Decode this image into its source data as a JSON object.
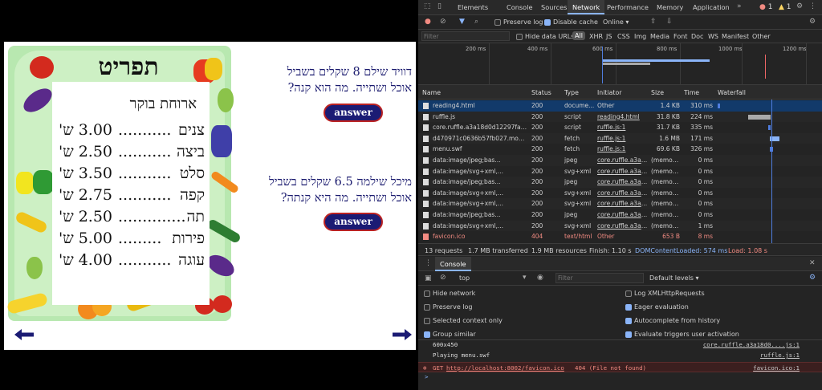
{
  "game": {
    "menu_title": "תפריט",
    "menu_subtitle": "ארוחת בוקר",
    "items": [
      {
        "name": "צנים",
        "dots": "...........",
        "price": "3.00 ש'"
      },
      {
        "name": "ביצה",
        "dots": "...........",
        "price": "2.50 ש'"
      },
      {
        "name": "סלט",
        "dots": "...........",
        "price": "3.50 ש'"
      },
      {
        "name": "קפה",
        "dots": "...........",
        "price": "2.75 ש'"
      },
      {
        "name": "תה",
        "dots": "..............",
        "price": "2.50 ש'"
      },
      {
        "name": "פירות",
        "dots": ".........",
        "price": "5.00 ש'"
      },
      {
        "name": "עוגה",
        "dots": "...........",
        "price": "4.00 ש'"
      }
    ],
    "question1_line1": "דוויד שילם 8 שקלים בשביל",
    "question1_line2": "אוכל ושתייה. מה הוא קנה?",
    "question2_line1": "מיכל שילמה 6.5 שקלים בשביל",
    "question2_line2": "אוכל ושתייה. מה היא קנתה?",
    "answer_label": "answer",
    "arrow_left": "←",
    "arrow_right": "→"
  },
  "devtools": {
    "tabs": [
      "Elements",
      "Console",
      "Sources",
      "Network",
      "Performance",
      "Memory",
      "Application"
    ],
    "active_tab": "Network",
    "more_tabs": "»",
    "error_count": "1",
    "warn_count": "1",
    "toolbar": {
      "preserve_log": "Preserve log",
      "disable_cache": "Disable cache",
      "throttle": "Online"
    },
    "filter": {
      "placeholder": "Filter",
      "hide_data_urls": "Hide data URLs",
      "types": [
        "All",
        "XHR",
        "JS",
        "CSS",
        "Img",
        "Media",
        "Font",
        "Doc",
        "WS",
        "Manifest",
        "Other"
      ]
    },
    "timeline_ticks": [
      "200 ms",
      "400 ms",
      "600 ms",
      "800 ms",
      "1000 ms",
      "1200 ms"
    ],
    "columns": {
      "name": "Name",
      "status": "Status",
      "type": "Type",
      "initiator": "Initiator",
      "size": "Size",
      "time": "Time",
      "waterfall": "Waterfall"
    },
    "requests": [
      {
        "name": "reading4.html",
        "status": "200",
        "type": "docume...",
        "initiator": "Other",
        "size": "1.4 KB",
        "time": "310 ms"
      },
      {
        "name": "ruffle.js",
        "status": "200",
        "type": "script",
        "initiator": "reading4.html",
        "size": "31.8 KB",
        "time": "224 ms"
      },
      {
        "name": "core.ruffle.a3a18d0d12297fa71...",
        "status": "200",
        "type": "script",
        "initiator": "ruffle.js:1",
        "size": "31.7 KB",
        "time": "335 ms"
      },
      {
        "name": "d470971c0636b57fb027.modul...",
        "status": "200",
        "type": "fetch",
        "initiator": "ruffle.js:1",
        "size": "1.6 MB",
        "time": "171 ms"
      },
      {
        "name": "menu.swf",
        "status": "200",
        "type": "fetch",
        "initiator": "ruffle.js:1",
        "size": "69.6 KB",
        "time": "326 ms"
      },
      {
        "name": "data:image/jpeg;bas...",
        "status": "200",
        "type": "jpeg",
        "initiator": "core.ruffle.a3a1...",
        "size": "(memor...",
        "time": "0 ms"
      },
      {
        "name": "data:image/svg+xml,...",
        "status": "200",
        "type": "svg+xml",
        "initiator": "core.ruffle.a3a1...",
        "size": "(memor...",
        "time": "0 ms"
      },
      {
        "name": "data:image/jpeg;bas...",
        "status": "200",
        "type": "jpeg",
        "initiator": "core.ruffle.a3a1...",
        "size": "(memor...",
        "time": "0 ms"
      },
      {
        "name": "data:image/svg+xml,...",
        "status": "200",
        "type": "svg+xml",
        "initiator": "core.ruffle.a3a1...",
        "size": "(memor...",
        "time": "0 ms"
      },
      {
        "name": "data:image/svg+xml,...",
        "status": "200",
        "type": "svg+xml",
        "initiator": "core.ruffle.a3a1...",
        "size": "(memor...",
        "time": "0 ms"
      },
      {
        "name": "data:image/jpeg;bas...",
        "status": "200",
        "type": "jpeg",
        "initiator": "core.ruffle.a3a1...",
        "size": "(memor...",
        "time": "0 ms"
      },
      {
        "name": "data:image/svg+xml,...",
        "status": "200",
        "type": "svg+xml",
        "initiator": "core.ruffle.a3a1...",
        "size": "(memor...",
        "time": "1 ms"
      },
      {
        "name": "favicon.ico",
        "status": "404",
        "type": "text/html",
        "initiator": "Other",
        "size": "653 B",
        "time": "8 ms"
      }
    ],
    "summary": {
      "requests": "13 requests",
      "transferred": "1.7 MB transferred",
      "resources": "1.9 MB resources",
      "finish": "Finish: 1.10 s",
      "dcl": "DOMContentLoaded: 574 ms",
      "load": "Load: 1.08 s"
    },
    "drawer_tab": "Console",
    "console": {
      "context": "top",
      "filter_placeholder": "Filter",
      "levels": "Default levels",
      "settings_left": [
        "Hide network",
        "Preserve log",
        "Selected context only",
        "Group similar"
      ],
      "settings_right": [
        "Log XMLHttpRequests",
        "Eager evaluation",
        "Autocomplete from history",
        "Evaluate triggers user activation"
      ],
      "messages": [
        {
          "text": "600x450",
          "source": "core.ruffle.a3a18d0....js:1"
        },
        {
          "text": "Playing menu.swf",
          "source": "ruffle.js:1"
        }
      ],
      "error_prefix": "GET",
      "error_url": "http://localhost:8002/favicon.ico",
      "error_suffix": "404 (File not found)",
      "error_source": "favicon.ico:1",
      "prompt": ">"
    },
    "colors": {
      "accent": "#8ab4f8",
      "error": "#f28b82",
      "selected_row": "#123a6a"
    }
  }
}
